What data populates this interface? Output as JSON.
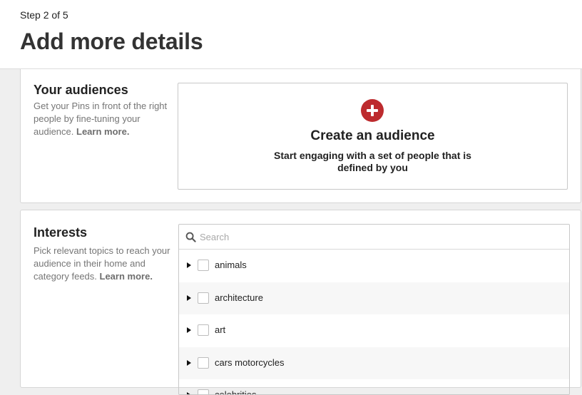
{
  "header": {
    "step": "Step 2 of 5",
    "title": "Add more details"
  },
  "audiences": {
    "heading": "Your audiences",
    "description": "Get your Pins in front of the right people by fine-tuning your audience.",
    "learn_more": "Learn more.",
    "create_title": "Create an audience",
    "create_subtitle": "Start engaging with a set of people that is defined by you",
    "plus_icon": "plus-circle-icon",
    "accent_color": "#bd2b2e"
  },
  "interests": {
    "heading": "Interests",
    "description": "Pick relevant topics to reach your audience in their home and category feeds.",
    "learn_more": "Learn more.",
    "search_placeholder": "Search",
    "search_icon": "search-icon",
    "items": [
      {
        "label": "animals",
        "checked": false
      },
      {
        "label": "architecture",
        "checked": false
      },
      {
        "label": "art",
        "checked": false
      },
      {
        "label": "cars motorcycles",
        "checked": false
      },
      {
        "label": "celebrities",
        "checked": false
      }
    ]
  }
}
